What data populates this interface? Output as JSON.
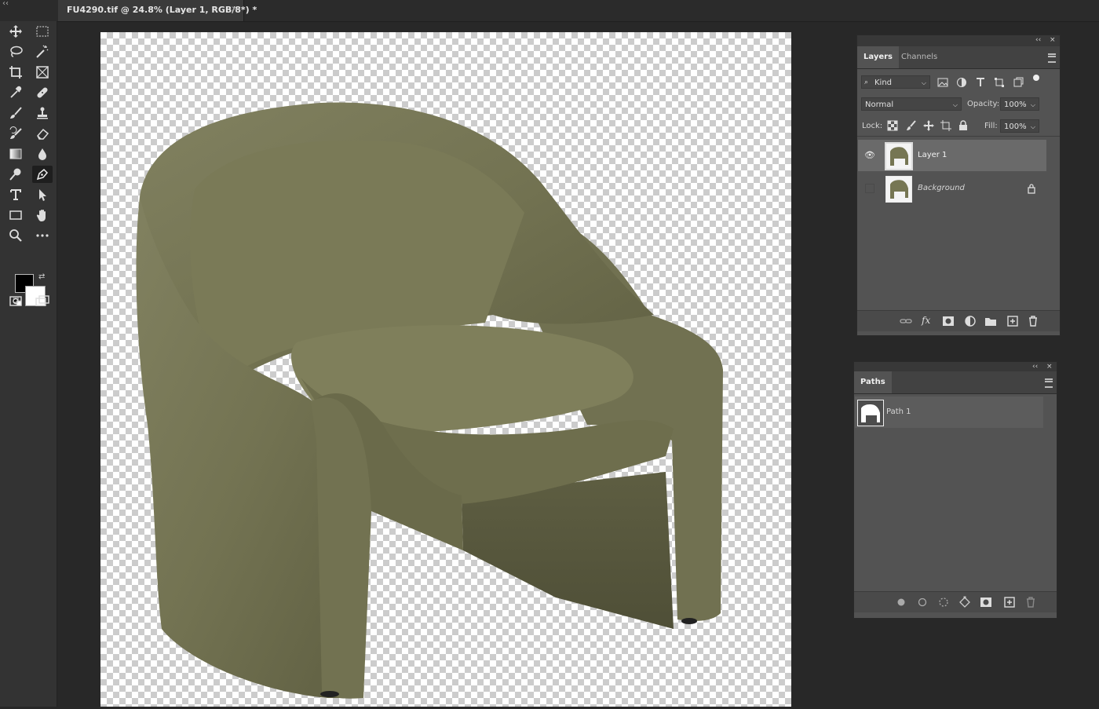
{
  "document": {
    "tab_label": "FU4290.tif @ 24.8% (Layer 1, RGB/8*) *",
    "close_glyph": "×",
    "collapse_glyph": "‹‹"
  },
  "toolbar": {
    "tools": [
      "move-tool",
      "rectangular-marquee-tool",
      "lasso-tool",
      "magic-wand-tool",
      "crop-tool",
      "frame-tool",
      "eyedropper-tool",
      "healing-brush-tool",
      "brush-tool",
      "clone-stamp-tool",
      "history-brush-tool",
      "eraser-tool",
      "gradient-tool",
      "blur-tool",
      "dodge-tool",
      "pen-tool",
      "type-tool",
      "path-selection-tool",
      "rectangle-tool",
      "hand-tool",
      "zoom-tool",
      "more-tools",
      "quick-mask-mode",
      "screen-mode"
    ],
    "active_tool": "pen-tool",
    "foreground_color": "#000000",
    "background_color": "#ffffff"
  },
  "canvas": {
    "subject": "olive green upholstered armchair",
    "chair_color": "#767653"
  },
  "layers_panel": {
    "tabs": [
      "Layers",
      "Channels"
    ],
    "active_tab": "Layers",
    "filter_kind": "Kind",
    "blend_mode": "Normal",
    "opacity_label": "Opacity:",
    "opacity_value": "100%",
    "lock_label": "Lock:",
    "fill_label": "Fill:",
    "fill_value": "100%",
    "layers": [
      {
        "name": "Layer 1",
        "visible": true,
        "selected": true,
        "locked": false
      },
      {
        "name": "Background",
        "visible": false,
        "selected": false,
        "locked": true
      }
    ],
    "footer_icons": [
      "link-layers-icon",
      "fx-icon",
      "add-mask-icon",
      "adjustment-layer-icon",
      "new-group-icon",
      "new-layer-icon",
      "delete-layer-icon"
    ],
    "fx_label": "fx"
  },
  "paths_panel": {
    "tabs": [
      "Paths"
    ],
    "active_tab": "Paths",
    "paths": [
      {
        "name": "Path 1"
      }
    ],
    "footer_icons": [
      "fill-path-icon",
      "stroke-path-icon",
      "load-selection-icon",
      "make-work-path-icon",
      "add-mask-icon",
      "new-path-icon",
      "delete-path-icon"
    ]
  },
  "panel_controls": {
    "collapse_glyph": "‹‹",
    "close_glyph": "×"
  }
}
